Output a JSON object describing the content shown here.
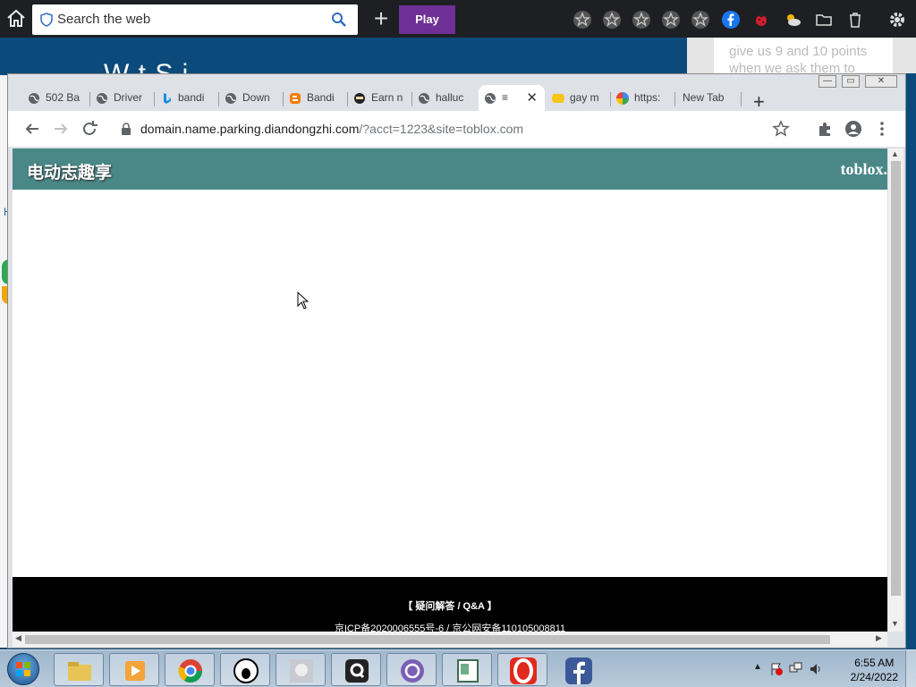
{
  "topbar": {
    "search_placeholder": "Search the web",
    "play_label": "Play",
    "icons": [
      "home-icon",
      "shield-icon",
      "search-icon",
      "plus-icon",
      "star-icon",
      "star-icon",
      "star-icon",
      "star-icon",
      "star-icon",
      "facebook-icon",
      "ladybug-icon",
      "weather-icon",
      "folder-icon",
      "trash-icon",
      "gear-icon"
    ]
  },
  "background_page": {
    "heading": "W           t     S       i",
    "card_line1": "give us 9 and 10 points",
    "card_line2": "when we ask them to",
    "left_letter": "H"
  },
  "browser": {
    "tabs": [
      {
        "title": "502 Ba"
      },
      {
        "title": "Driver"
      },
      {
        "title": "bandi"
      },
      {
        "title": "Down"
      },
      {
        "title": "Bandi"
      },
      {
        "title": "Earn n"
      },
      {
        "title": "halluc"
      },
      {
        "title": "≡",
        "active": true
      },
      {
        "title": "gay m"
      },
      {
        "title": "https:"
      },
      {
        "title": "New Tab"
      }
    ],
    "url_host": "domain.name.parking.diandongzhi.com",
    "url_path": "/?acct=1223&site=toblox.com"
  },
  "page": {
    "site_title": "电动志趣享",
    "domain_label": "toblox.",
    "footer_faq": "【 疑问解答 / Q&A 】",
    "footer_icp": "京ICP备2020006555号-6 / 京公网安备110105008811"
  },
  "taskbar": {
    "time": "6:55 AM",
    "date": "2/24/2022",
    "apps": [
      "windows-explorer-icon",
      "media-player-icon",
      "chrome-icon",
      "screamer-icon",
      "photo-app-icon",
      "q-app-icon",
      "at-app-icon",
      "notebook-icon",
      "opera-icon",
      "facebook-icon"
    ]
  },
  "colors": {
    "site_header": "#4a8787",
    "play_button": "#6e2f96",
    "footer": "#000000"
  }
}
